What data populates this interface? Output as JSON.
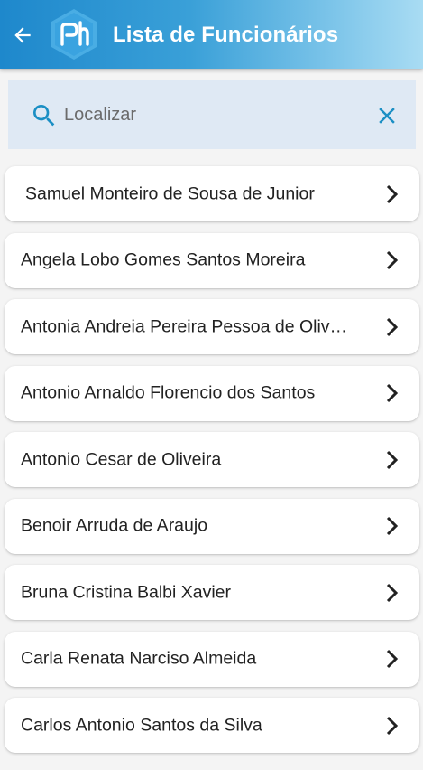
{
  "appbar": {
    "title": "Lista de Funcionários",
    "logo": "ph-hexagon-logo"
  },
  "search": {
    "placeholder": "Localizar",
    "value": ""
  },
  "employees": [
    "Samuel Monteiro de Sousa de Junior",
    "Angela Lobo Gomes Santos Moreira",
    "Antonia Andreia Pereira Pessoa de Oliveira",
    "Antonio Arnaldo Florencio dos Santos",
    "Antonio Cesar de Oliveira",
    "Benoir Arruda de Araujo",
    "Bruna Cristina Balbi Xavier",
    "Carla Renata Narciso Almeida",
    "Carlos Antonio Santos da Silva"
  ],
  "colors": {
    "appbar_start": "#1e88cc",
    "appbar_end": "#a9dcf3",
    "search_bg": "#dfe9f4",
    "accent_icon": "#1b8fc4"
  }
}
